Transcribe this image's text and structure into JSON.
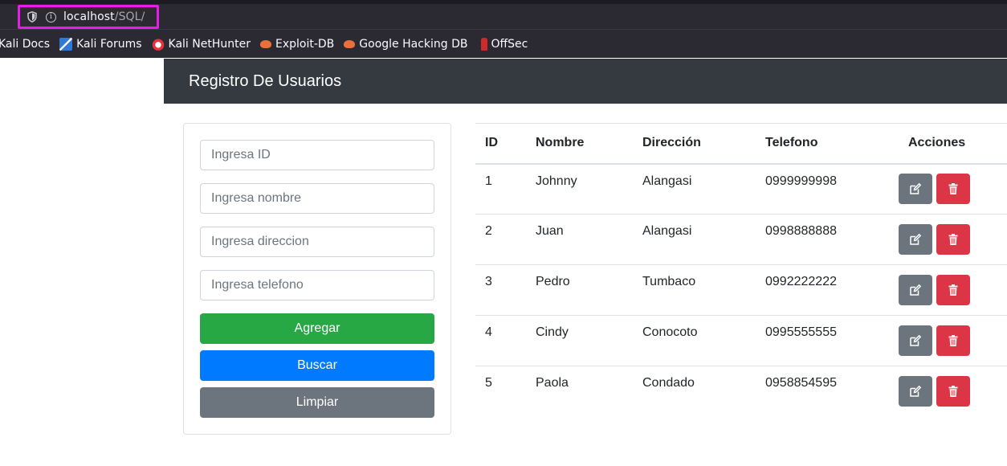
{
  "browser": {
    "url_host": "localhost",
    "url_path": "/SQL/",
    "bookmarks": [
      {
        "label": "Kali Docs",
        "icon": "kali-docs-icon"
      },
      {
        "label": "Kali Forums",
        "icon": "kali-forums-icon"
      },
      {
        "label": "Kali NetHunter",
        "icon": "kali-nethunter-icon"
      },
      {
        "label": "Exploit-DB",
        "icon": "exploit-db-icon"
      },
      {
        "label": "Google Hacking DB",
        "icon": "ghdb-icon"
      },
      {
        "label": "OffSec",
        "icon": "offsec-icon"
      }
    ]
  },
  "navbar": {
    "brand": "Registro De Usuarios"
  },
  "form": {
    "id_placeholder": "Ingresa ID",
    "nombre_placeholder": "Ingresa nombre",
    "direccion_placeholder": "Ingresa direccion",
    "telefono_placeholder": "Ingresa telefono",
    "agregar_label": "Agregar",
    "buscar_label": "Buscar",
    "limpiar_label": "Limpiar"
  },
  "table": {
    "headers": [
      "ID",
      "Nombre",
      "Dirección",
      "Telefono",
      "Acciones"
    ],
    "rows": [
      {
        "id": "1",
        "nombre": "Johnny",
        "direccion": "Alangasi",
        "telefono": "0999999998"
      },
      {
        "id": "2",
        "nombre": "Juan",
        "direccion": "Alangasi",
        "telefono": "0998888888"
      },
      {
        "id": "3",
        "nombre": "Pedro",
        "direccion": "Tumbaco",
        "telefono": "0992222222"
      },
      {
        "id": "4",
        "nombre": "Cindy",
        "direccion": "Conocoto",
        "telefono": "0995555555"
      },
      {
        "id": "5",
        "nombre": "Paola",
        "direccion": "Condado",
        "telefono": "0958854595"
      }
    ]
  },
  "colors": {
    "navbar": "#343a40",
    "success": "#28a745",
    "primary": "#007bff",
    "secondary": "#6c757d",
    "danger": "#dc3545",
    "url_highlight": "#e81ce8"
  }
}
